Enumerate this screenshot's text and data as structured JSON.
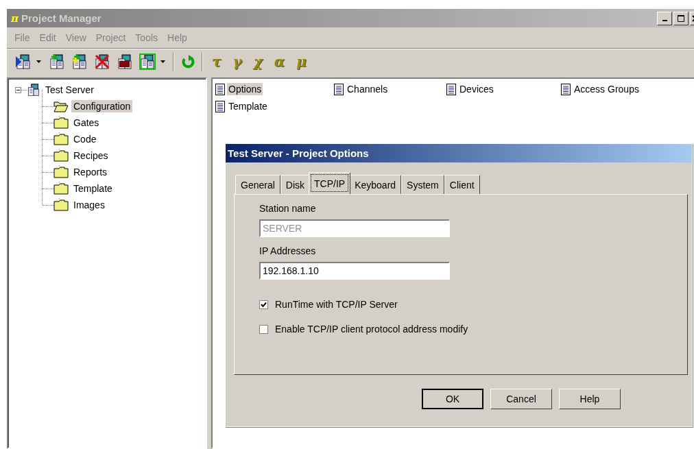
{
  "window": {
    "icon_glyph": "π",
    "title": "Project Manager",
    "active": false
  },
  "menu": [
    "File",
    "Edit",
    "View",
    "Project",
    "Tools",
    "Help"
  ],
  "toolbar": {
    "symbols": [
      "τ",
      "γ",
      "χ",
      "α",
      "μ"
    ]
  },
  "tree": {
    "label": "Test Server",
    "expanded": true,
    "children": [
      {
        "label": "Configuration",
        "selected": true,
        "open": true
      },
      {
        "label": "Gates",
        "selected": false,
        "open": false
      },
      {
        "label": "Code",
        "selected": false,
        "open": false
      },
      {
        "label": "Recipes",
        "selected": false,
        "open": false
      },
      {
        "label": "Reports",
        "selected": false,
        "open": false
      },
      {
        "label": "Template",
        "selected": false,
        "open": false
      },
      {
        "label": "Images",
        "selected": false,
        "open": false
      }
    ]
  },
  "items": [
    {
      "label": "Options",
      "selected": true
    },
    {
      "label": "Channels",
      "selected": false
    },
    {
      "label": "Devices",
      "selected": false
    },
    {
      "label": "Access Groups",
      "selected": false
    },
    {
      "label": "Template",
      "selected": false
    }
  ],
  "dialog": {
    "title": "Test Server - Project Options",
    "tabs": [
      {
        "label": "General",
        "selected": false
      },
      {
        "label": "Disk",
        "selected": false
      },
      {
        "label": "TCP/IP",
        "selected": true
      },
      {
        "label": "Keyboard",
        "selected": false
      },
      {
        "label": "System",
        "selected": false
      },
      {
        "label": "Client",
        "selected": false
      }
    ],
    "fields": [
      {
        "label": "Station name",
        "value": "SERVER",
        "disabled": true
      },
      {
        "label": "IP Addresses",
        "value": "192.168.1.10",
        "disabled": false
      }
    ],
    "checkboxes": [
      {
        "label": "RunTime with TCP/IP Server",
        "checked": true
      },
      {
        "label": "Enable TCP/IP client protocol address modify",
        "checked": false
      }
    ],
    "buttons": [
      {
        "label": "OK",
        "default": true
      },
      {
        "label": "Cancel",
        "default": false
      },
      {
        "label": "Help",
        "default": false
      }
    ]
  }
}
